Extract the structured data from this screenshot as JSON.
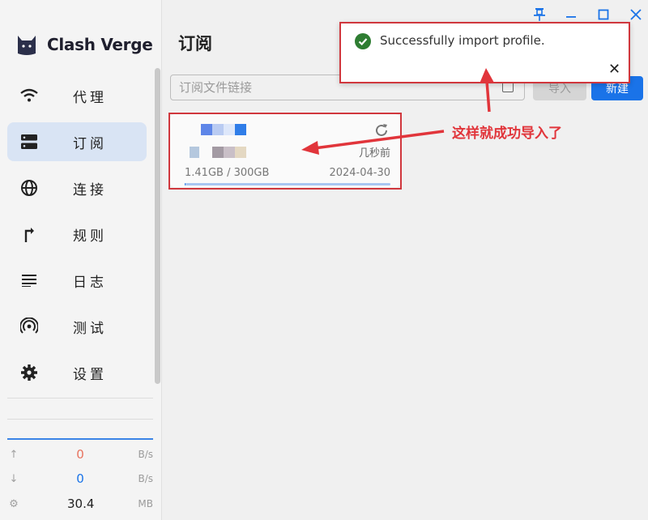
{
  "app": {
    "name": "Clash Verge"
  },
  "titlebar": {
    "pin_icon": "pin-icon",
    "minimize_icon": "minimize-icon",
    "maximize_icon": "maximize-icon",
    "close_icon": "close-icon"
  },
  "sidebar": {
    "items": [
      {
        "label": "代理",
        "icon": "wifi-icon",
        "active": false
      },
      {
        "label": "订阅",
        "icon": "server-icon",
        "active": true
      },
      {
        "label": "连接",
        "icon": "globe-icon",
        "active": false
      },
      {
        "label": "规则",
        "icon": "route-icon",
        "active": false
      },
      {
        "label": "日志",
        "icon": "list-icon",
        "active": false
      },
      {
        "label": "测试",
        "icon": "broadcast-icon",
        "active": false
      },
      {
        "label": "设置",
        "icon": "gear-icon",
        "active": false
      }
    ]
  },
  "traffic": {
    "upload": {
      "value": "0",
      "unit": "B/s",
      "color": "#e8735f"
    },
    "download": {
      "value": "0",
      "unit": "B/s",
      "color": "#1a73e8"
    },
    "memory": {
      "value": "30.4",
      "unit": "MB"
    }
  },
  "main": {
    "title": "订阅",
    "url_placeholder": "订阅文件链接",
    "import_label": "导入",
    "new_label": "新建"
  },
  "profile_card": {
    "updated": "几秒前",
    "usage": "1.41GB / 300GB",
    "expire_date": "2024-04-30",
    "usage_fraction": 0.0047
  },
  "toast": {
    "message": "Successfully import profile."
  },
  "annotation": {
    "text": "这样就成功导入了",
    "color": "#e1353b"
  }
}
